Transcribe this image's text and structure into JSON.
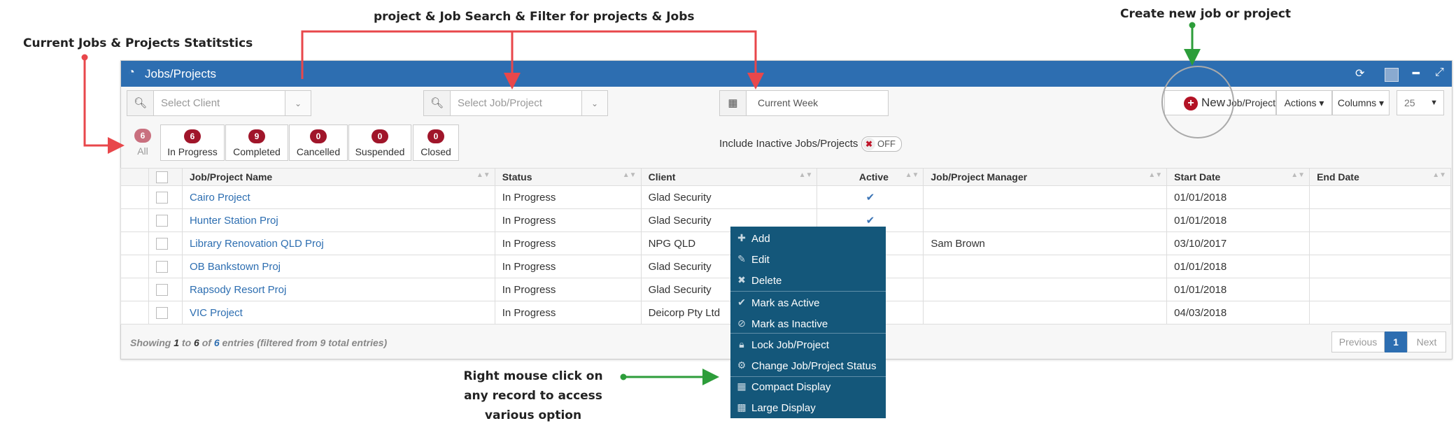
{
  "annotations": {
    "stats": "Current Jobs & Projects Statitstics",
    "search": "project & Job Search & Filter for projects & Jobs",
    "create": "Create new job or project",
    "right_click": [
      "Right mouse click on",
      "any record to access",
      "various option"
    ]
  },
  "panel": {
    "title": "Jobs/Projects"
  },
  "filters": {
    "client_placeholder": "Select Client",
    "job_placeholder": "Select Job/Project",
    "date_value": "Current Week"
  },
  "toolbar": {
    "new_label": "New",
    "new_suffix": "Job/Project",
    "actions_label": "Actions",
    "columns_label": "Columns",
    "page_size": "25"
  },
  "stats": [
    {
      "count": "6",
      "label": "All"
    },
    {
      "count": "6",
      "label": "In Progress"
    },
    {
      "count": "9",
      "label": "Completed"
    },
    {
      "count": "0",
      "label": "Cancelled"
    },
    {
      "count": "0",
      "label": "Suspended"
    },
    {
      "count": "0",
      "label": "Closed"
    }
  ],
  "inactive_toggle": {
    "label": "Include Inactive Jobs/Projects",
    "state": "OFF"
  },
  "table": {
    "columns": [
      "Job/Project Name",
      "Status",
      "Client",
      "Active",
      "Job/Project Manager",
      "Start Date",
      "End Date"
    ],
    "rows": [
      {
        "name": "Cairo Project",
        "status": "In Progress",
        "client": "Glad Security",
        "active": "✔",
        "manager": "",
        "start": "01/01/2018",
        "end": ""
      },
      {
        "name": "Hunter Station Proj",
        "status": "In Progress",
        "client": "Glad Security",
        "active": "✔",
        "manager": "",
        "start": "01/01/2018",
        "end": ""
      },
      {
        "name": "Library Renovation QLD Proj",
        "status": "In Progress",
        "client": "NPG QLD",
        "active": "",
        "manager": "Sam Brown",
        "start": "03/10/2017",
        "end": ""
      },
      {
        "name": "OB Bankstown Proj",
        "status": "In Progress",
        "client": "Glad Security",
        "active": "",
        "manager": "",
        "start": "01/01/2018",
        "end": ""
      },
      {
        "name": "Rapsody Resort Proj",
        "status": "In Progress",
        "client": "Glad Security",
        "active": "",
        "manager": "",
        "start": "01/01/2018",
        "end": ""
      },
      {
        "name": "VIC Project",
        "status": "In Progress",
        "client": "Deicorp Pty Ltd",
        "active": "",
        "manager": "",
        "start": "04/03/2018",
        "end": ""
      }
    ]
  },
  "footer": {
    "showing": "Showing",
    "from": "1",
    "to_word": "to",
    "to": "6",
    "of_word": "of",
    "total": "6",
    "suffix": "entries (filtered from 9 total entries)"
  },
  "pagination": {
    "previous": "Previous",
    "page": "1",
    "next": "Next"
  },
  "context_menu": [
    {
      "icon": "plus-icon",
      "label": "Add"
    },
    {
      "icon": "edit-icon",
      "label": "Edit"
    },
    {
      "icon": "close-icon",
      "label": "Delete"
    },
    {
      "icon": "check-icon",
      "label": "Mark as Active"
    },
    {
      "icon": "ban-icon",
      "label": "Mark as Inactive"
    },
    {
      "icon": "lock-icon",
      "label": "Lock Job/Project"
    },
    {
      "icon": "gear-icon",
      "label": "Change Job/Project Status"
    },
    {
      "icon": "table-icon",
      "label": "Compact Display"
    },
    {
      "icon": "grid-icon",
      "label": "Large Display"
    }
  ],
  "colors": {
    "header": "#2d6eb1",
    "badge": "#a0152a",
    "menu": "#14577a",
    "red_arrow": "#e8474b",
    "green_arrow": "#2d9d3a"
  }
}
